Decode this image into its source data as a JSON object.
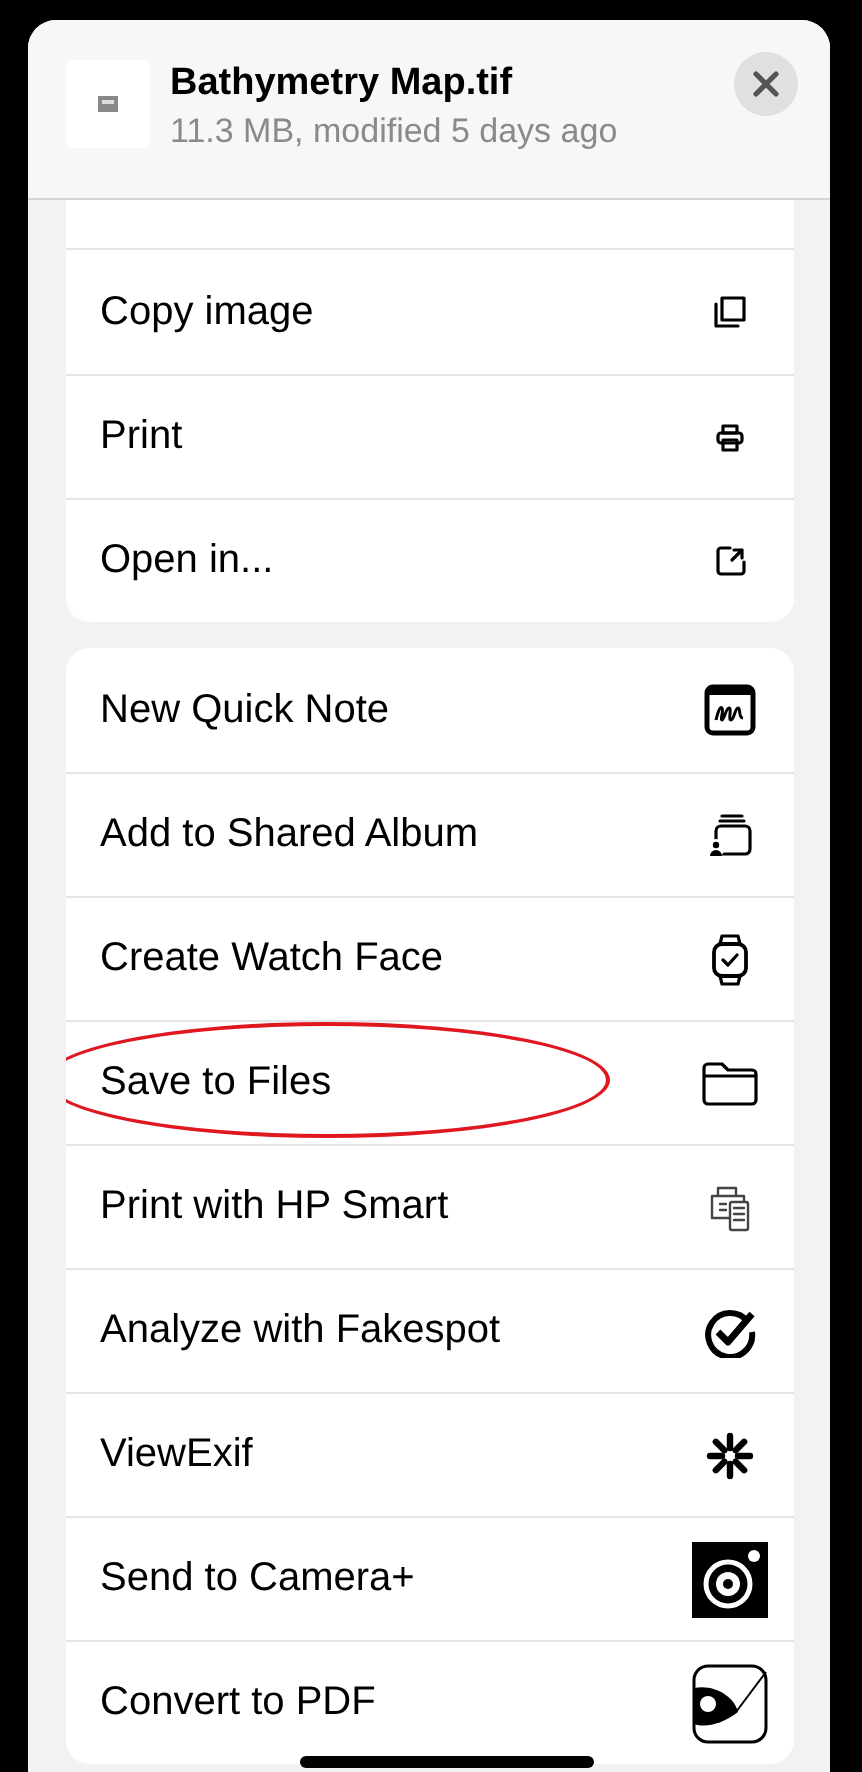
{
  "file": {
    "title": "Bathymetry Map.tif",
    "subtitle": "11.3 MB, modified 5 days ago"
  },
  "groups": [
    {
      "items": [
        {
          "label": "Copy image",
          "kind": "copy",
          "circled": false
        },
        {
          "label": "Print",
          "kind": "print",
          "circled": false
        },
        {
          "label": "Open in...",
          "kind": "open",
          "circled": false
        }
      ]
    },
    {
      "items": [
        {
          "label": "New Quick Note",
          "kind": "note",
          "circled": false
        },
        {
          "label": "Add to Shared Album",
          "kind": "album",
          "circled": false
        },
        {
          "label": "Create Watch Face",
          "kind": "watch",
          "circled": false
        },
        {
          "label": "Save to Files",
          "kind": "folder",
          "circled": true
        },
        {
          "label": "Print with HP Smart",
          "kind": "hp",
          "circled": false
        },
        {
          "label": "Analyze with Fakespot",
          "kind": "check",
          "circled": false
        },
        {
          "label": "ViewExif",
          "kind": "burst",
          "circled": false
        },
        {
          "label": "Send to Camera+",
          "kind": "camera",
          "circled": false
        },
        {
          "label": "Convert to PDF",
          "kind": "pdf",
          "circled": false
        }
      ]
    }
  ]
}
